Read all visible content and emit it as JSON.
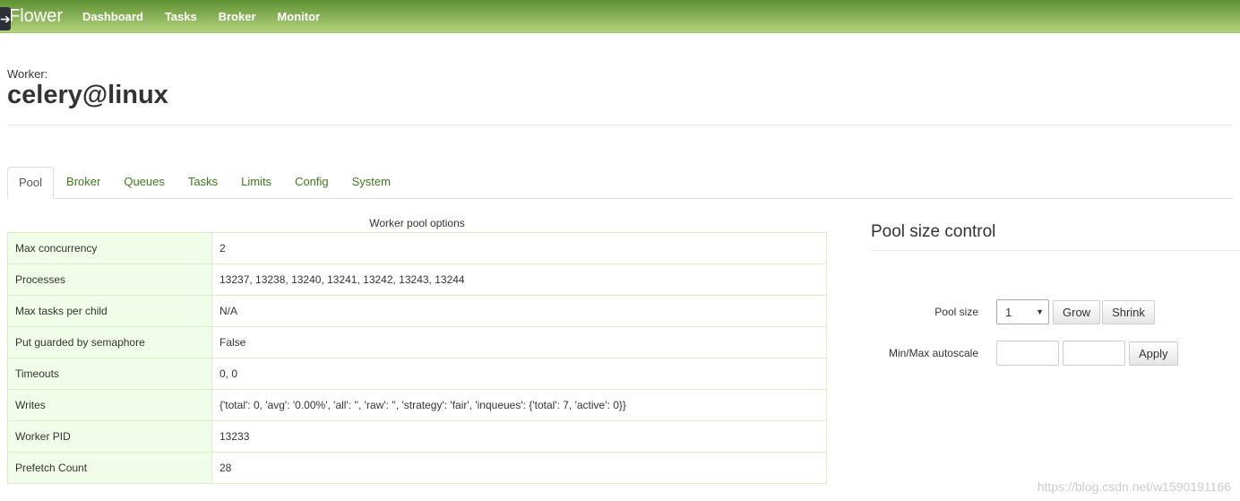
{
  "navbar": {
    "brand": "Flower",
    "items": [
      "Dashboard",
      "Tasks",
      "Broker",
      "Monitor"
    ],
    "color": "#5e9234"
  },
  "header": {
    "label": "Worker:",
    "name": "celery@linux"
  },
  "tabs": [
    "Pool",
    "Broker",
    "Queues",
    "Tasks",
    "Limits",
    "Config",
    "System"
  ],
  "pool": {
    "caption": "Worker pool options",
    "rows": [
      [
        "Max concurrency",
        "2"
      ],
      [
        "Processes",
        "13237, 13238, 13240, 13241, 13242, 13243, 13244"
      ],
      [
        "Max tasks per child",
        "N/A"
      ],
      [
        "Put guarded by semaphore",
        "False"
      ],
      [
        "Timeouts",
        "0, 0"
      ],
      [
        "Writes",
        "{'total': 0, 'avg': '0.00%', 'all': '', 'raw': '', 'strategy': 'fair', 'inqueues': {'total': 7, 'active': 0}}"
      ],
      [
        "Worker PID",
        "13233"
      ],
      [
        "Prefetch Count",
        "28"
      ]
    ]
  },
  "control": {
    "title": "Pool size control",
    "pool_size_label": "Pool size",
    "pool_size_value": "1",
    "grow": "Grow",
    "shrink": "Shrink",
    "autoscale_label": "Min/Max autoscale",
    "apply": "Apply"
  },
  "watermark": "https://blog.csdn.net/w1590191166"
}
